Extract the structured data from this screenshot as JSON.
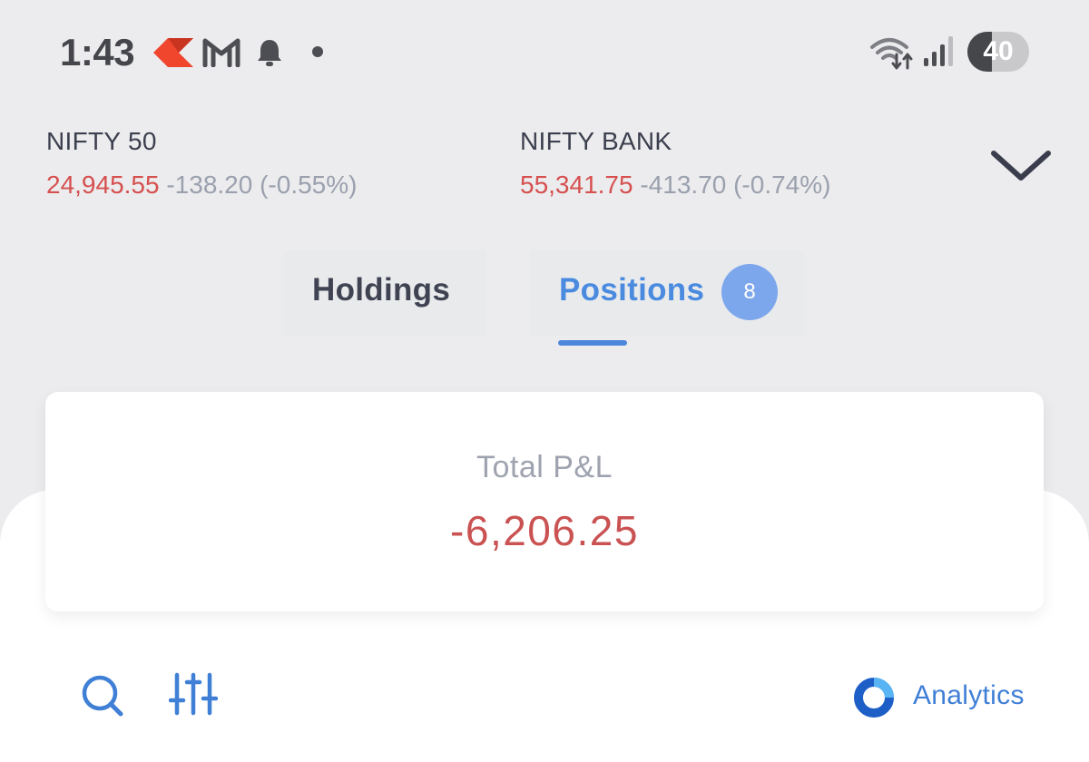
{
  "status_bar": {
    "time": "1:43",
    "notification_icons": [
      "kite-app-icon",
      "gmail-icon",
      "bell-icon",
      "dot-icon"
    ],
    "system_icons": [
      "wifi-icon",
      "signal-icon"
    ],
    "battery_level": "40",
    "battery_fraction": 0.4
  },
  "indices": [
    {
      "name": "NIFTY 50",
      "price": "24,945.55",
      "change": "-138.20 (-0.55%)"
    },
    {
      "name": "NIFTY BANK",
      "price": "55,341.75",
      "change": "-413.70 (-0.74%)"
    }
  ],
  "ticker_toggle_icon": "chevron-down-icon",
  "tabs": [
    {
      "label": "Holdings",
      "active": false
    },
    {
      "label": "Positions",
      "active": true,
      "badge": "8"
    }
  ],
  "pnl": {
    "label": "Total P&L",
    "value": "-6,206.25"
  },
  "toolbar": {
    "icons": [
      "search-icon",
      "filter-sliders-icon"
    ],
    "analytics_label": "Analytics",
    "analytics_icon": "analytics-donut-icon"
  },
  "colors": {
    "background": "#ececee",
    "negative": "#d6504f",
    "muted": "#9aa0ad",
    "accent": "#4a8be0",
    "badge": "#7da7ec",
    "kite_logo": "#f0462d"
  }
}
